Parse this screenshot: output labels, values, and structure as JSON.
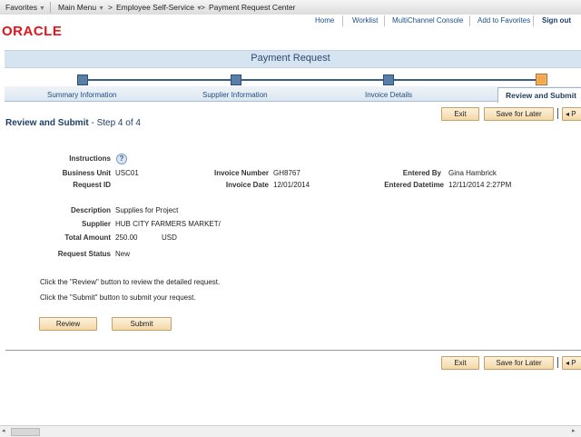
{
  "breadcrumb": {
    "favorites": "Favorites",
    "main_menu": "Main Menu",
    "self_service": "Employee Self-Service",
    "current": "Payment Request Center"
  },
  "header": {
    "links": [
      "Home",
      "Worklist",
      "MultiChannel Console",
      "Add to Favorites"
    ],
    "signout": "Sign out",
    "logo": "ORACLE"
  },
  "banner": {
    "title": "Payment Request"
  },
  "train": {
    "steps": [
      "Summary Information",
      "Supplier Information",
      "Invoice Details",
      "Review and Submit"
    ],
    "current_step": 4
  },
  "toolbar": {
    "exit": "Exit",
    "save_for_later": "Save for Later",
    "more": "◂ P"
  },
  "heading": {
    "title": "Review and Submit",
    "step": "- Step 4 of 4"
  },
  "details": {
    "instructions_label": "Instructions",
    "business_unit_label": "Business Unit",
    "business_unit": "USC01",
    "request_id_label": "Request ID",
    "invoice_number_label": "Invoice Number",
    "invoice_number": "GH8767",
    "invoice_date_label": "Invoice Date",
    "invoice_date": "12/01/2014",
    "entered_by_label": "Entered By",
    "entered_by": "Gina Hambrick",
    "entered_datetime_label": "Entered Datetime",
    "entered_datetime": "12/11/2014  2:27PM",
    "description_label": "Description",
    "description": "Supplies for Project",
    "supplier_label": "Supplier",
    "supplier": "HUB CITY FARMERS MARKET/",
    "total_amount_label": "Total Amount",
    "total_amount": "250.00",
    "currency": "USD",
    "request_status_label": "Request Status",
    "request_status": "New"
  },
  "messages": {
    "review": "Click the \"Review\" button to review the detailed request.",
    "submit": "Click the \"Submit\" button to submit your request."
  },
  "actions": {
    "review": "Review",
    "submit": "Submit"
  },
  "colors": {
    "accent": "#1f3f66",
    "button": "#f3d7a7",
    "logo": "#e4141b",
    "current_step": "#f5a64a"
  }
}
